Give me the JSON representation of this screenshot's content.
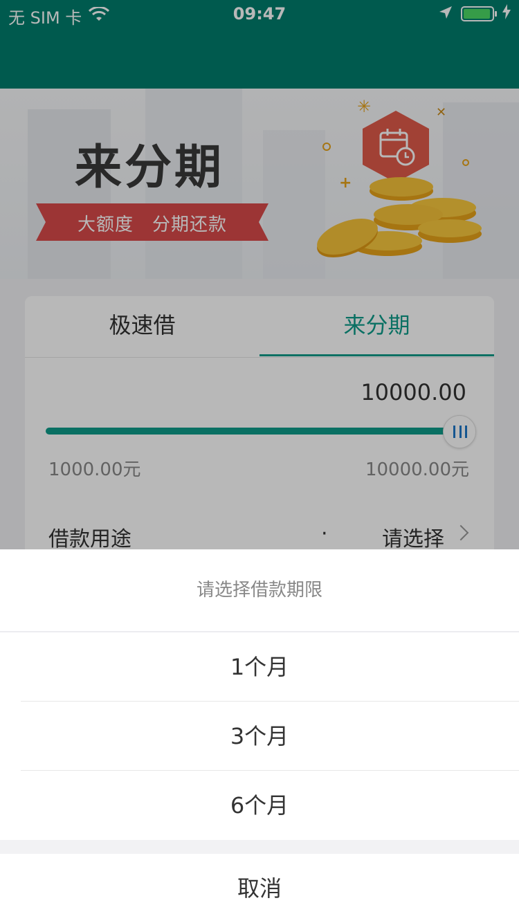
{
  "status_bar": {
    "carrier": "无 SIM 卡",
    "time": "09:47",
    "icons": [
      "wifi-icon",
      "location-icon",
      "battery-icon",
      "charging-icon"
    ]
  },
  "banner": {
    "title": "来分期",
    "ribbon_text": "大额度　分期还款",
    "icons": [
      "calendar-clock-icon",
      "gold-coins-illustration"
    ]
  },
  "tabs": [
    {
      "label": "极速借",
      "active": false
    },
    {
      "label": "来分期",
      "active": true
    }
  ],
  "loan": {
    "amount": "10000.00",
    "slider_fraction": 1.0,
    "min_label": "1000.00元",
    "max_label": "10000.00元",
    "purpose_label": "借款用途",
    "purpose_dot": "·",
    "purpose_value": "请选择"
  },
  "sheet": {
    "title": "请选择借款期限",
    "options": [
      "1个月",
      "3个月",
      "6个月"
    ],
    "cancel": "取消"
  },
  "colors": {
    "brand": "#007d6d",
    "accent": "#0e9c8a",
    "ribbon": "#d84a4a",
    "thumb_icon": "#1e78c8"
  }
}
